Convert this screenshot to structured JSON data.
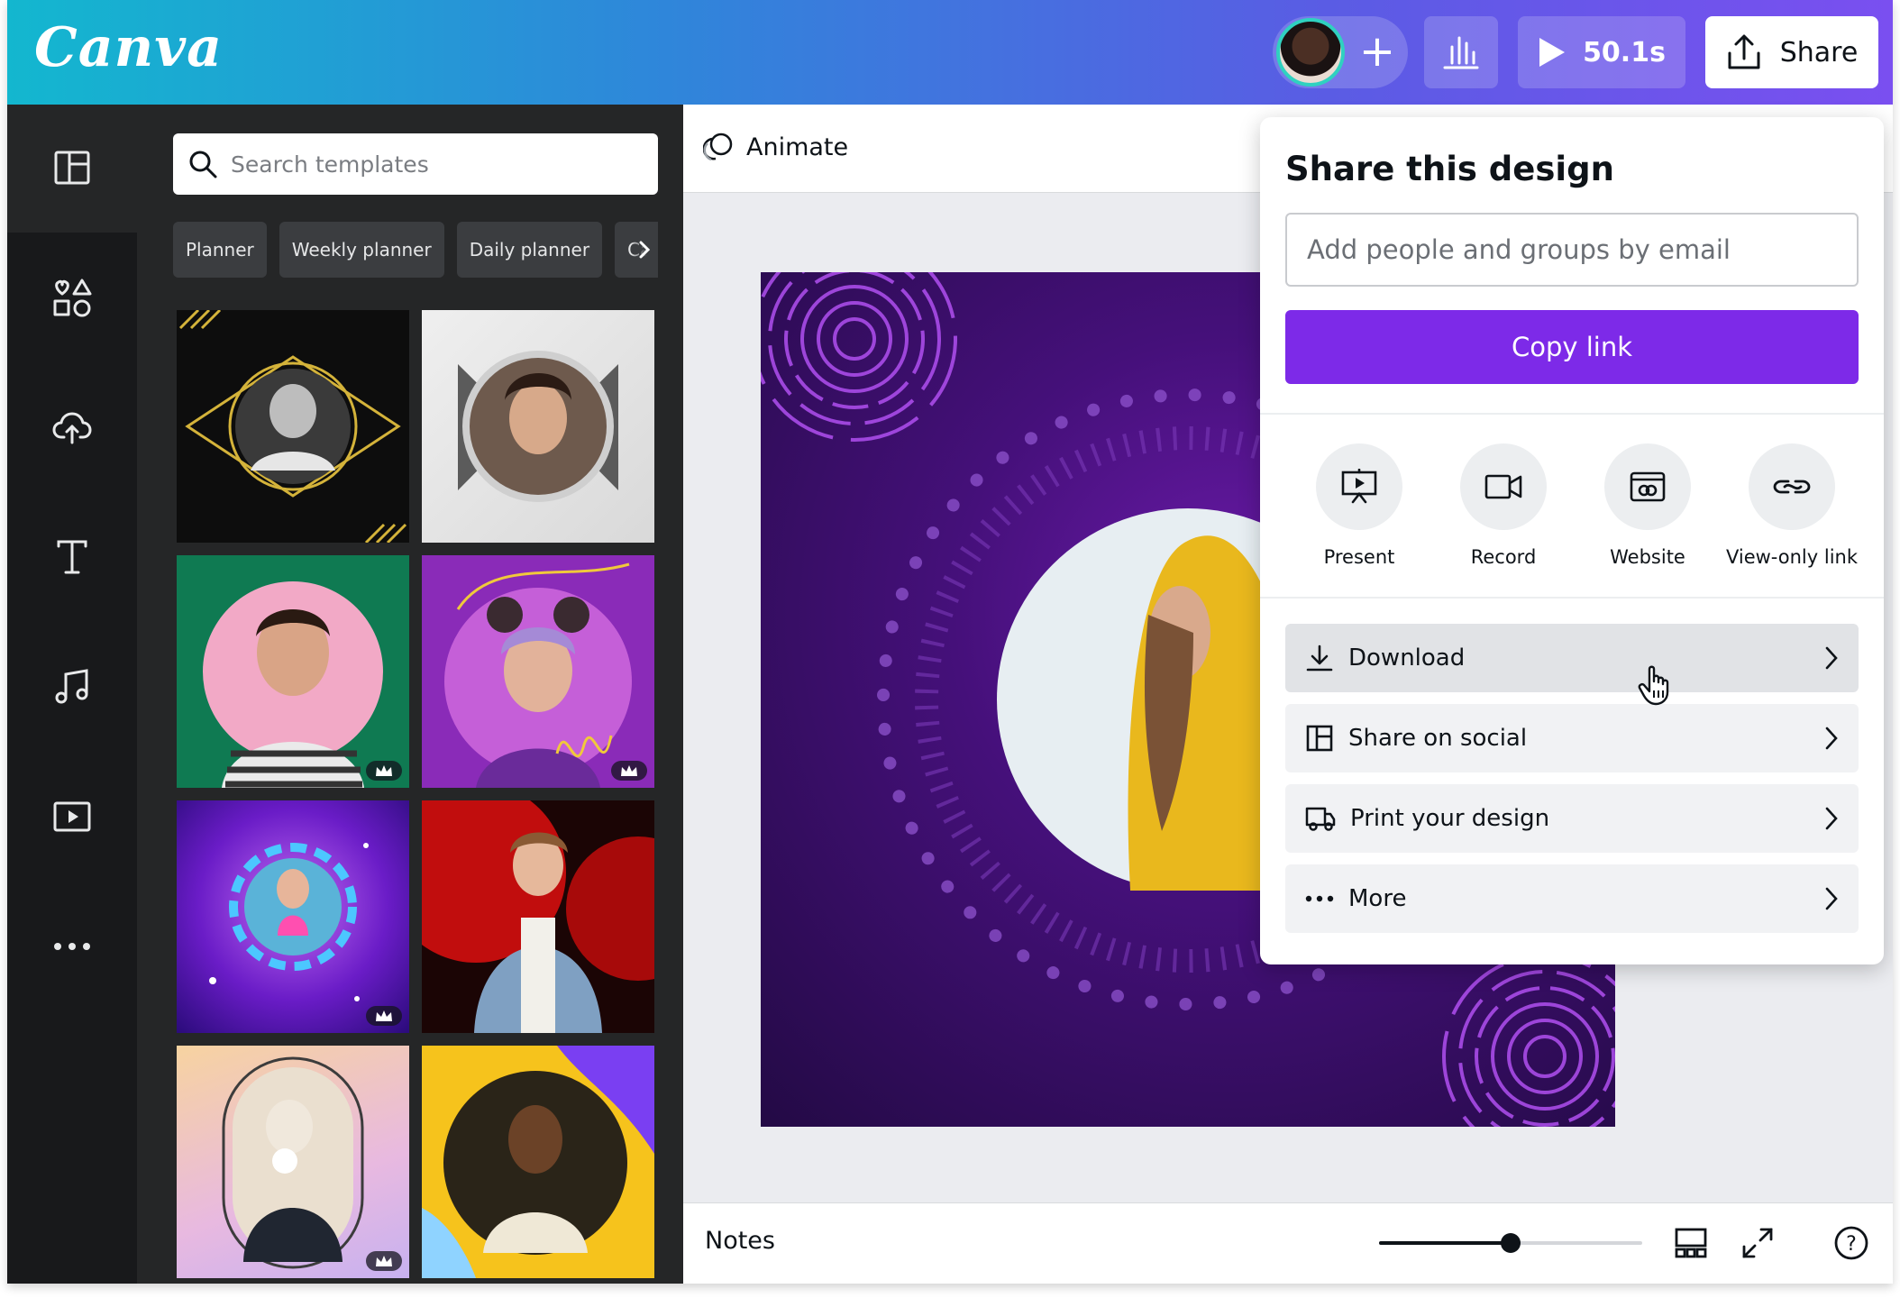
{
  "header": {
    "logo": "Canva",
    "timer": "50.1s",
    "share_label": "Share",
    "brand_gradient": [
      "#13b7cf",
      "#7a4ff0"
    ]
  },
  "rail": {
    "items": [
      "templates-icon",
      "elements-icon",
      "uploads-icon",
      "text-icon",
      "audio-icon",
      "videos-icon",
      "more-icon"
    ]
  },
  "panel": {
    "search_placeholder": "Search templates",
    "chips": [
      "Planner",
      "Weekly planner",
      "Daily planner",
      "Calendar"
    ]
  },
  "editor": {
    "animate_label": "Animate",
    "notes_label": "Notes",
    "zoom_fraction": 0.5
  },
  "share": {
    "title": "Share this design",
    "email_placeholder": "Add people and groups by email",
    "copy_link": "Copy link",
    "accent": "#7d2ae8",
    "actions": [
      {
        "label": "Present",
        "icon": "present-icon"
      },
      {
        "label": "Record",
        "icon": "record-icon"
      },
      {
        "label": "Website",
        "icon": "website-icon"
      },
      {
        "label": "View-only link",
        "icon": "link-icon"
      }
    ],
    "rows": [
      {
        "label": "Download",
        "icon": "download-icon"
      },
      {
        "label": "Share on social",
        "icon": "social-icon"
      },
      {
        "label": "Print your design",
        "icon": "truck-icon"
      },
      {
        "label": "More",
        "icon": "ellipsis-icon"
      }
    ]
  }
}
